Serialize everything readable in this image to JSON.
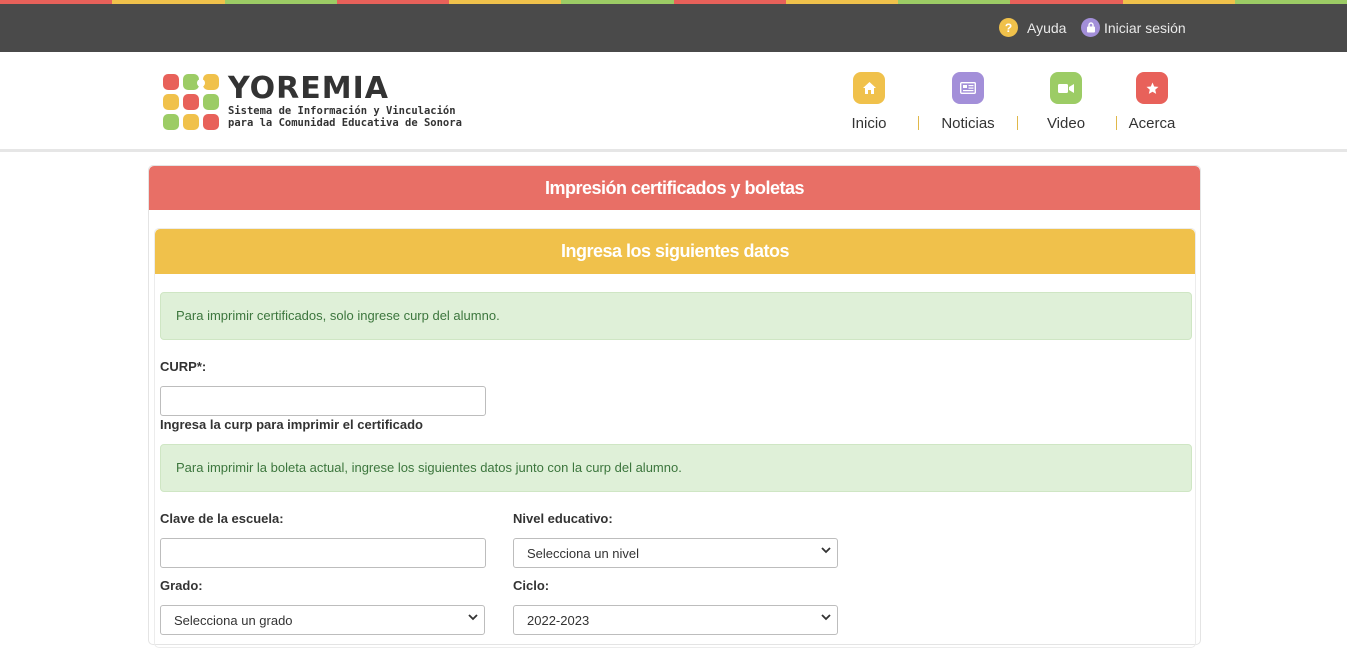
{
  "topbar": {
    "help_label": "Ayuda",
    "login_label": "Iniciar sesión",
    "stripe_colors": [
      "#e8615a",
      "#f0c14b",
      "#9ccc65",
      "#e8615a",
      "#f0c14b",
      "#9ccc65",
      "#e8615a",
      "#f0c14b",
      "#9ccc65",
      "#e8615a",
      "#f0c14b",
      "#9ccc65"
    ]
  },
  "brand": {
    "name": "YOREMIA",
    "tagline_line1": "Sistema de Información y Vinculación",
    "tagline_line2": "para la Comunidad Educativa de Sonora"
  },
  "nav": [
    {
      "label": "Inicio",
      "icon": "home-icon",
      "color": "#f0c14b"
    },
    {
      "label": "Noticias",
      "icon": "newspaper-icon",
      "color": "#a38fd9"
    },
    {
      "label": "Video",
      "icon": "video-camera-icon",
      "color": "#9ccc65"
    },
    {
      "label": "Acerca",
      "icon": "star-icon",
      "color": "#e8615a"
    }
  ],
  "panel": {
    "title": "Impresión certificados y boletas",
    "subtitle": "Ingresa los siguientes datos",
    "alert_certificados": "Para imprimir certificados, solo ingrese curp del alumno.",
    "curp_label": "CURP*:",
    "curp_value": "",
    "curp_help": "Ingresa la curp para imprimir el certificado",
    "alert_boleta": "Para imprimir la boleta actual, ingrese los siguientes datos junto con la curp del alumno.",
    "clave_label": "Clave de la escuela:",
    "clave_value": "",
    "nivel_label": "Nivel educativo:",
    "nivel_value": "Selecciona un nivel",
    "grado_label": "Grado:",
    "grado_value": "Selecciona un grado",
    "ciclo_label": "Ciclo:",
    "ciclo_value": "2022-2023"
  },
  "colors": {
    "topbar": "#4a4a4a",
    "panel_header": "#e86f66",
    "sub_header": "#f0c14b",
    "alert_bg": "#dff0d8",
    "alert_text": "#3c763d",
    "help_icon": "#f0c14b",
    "login_icon": "#a38fd9"
  }
}
